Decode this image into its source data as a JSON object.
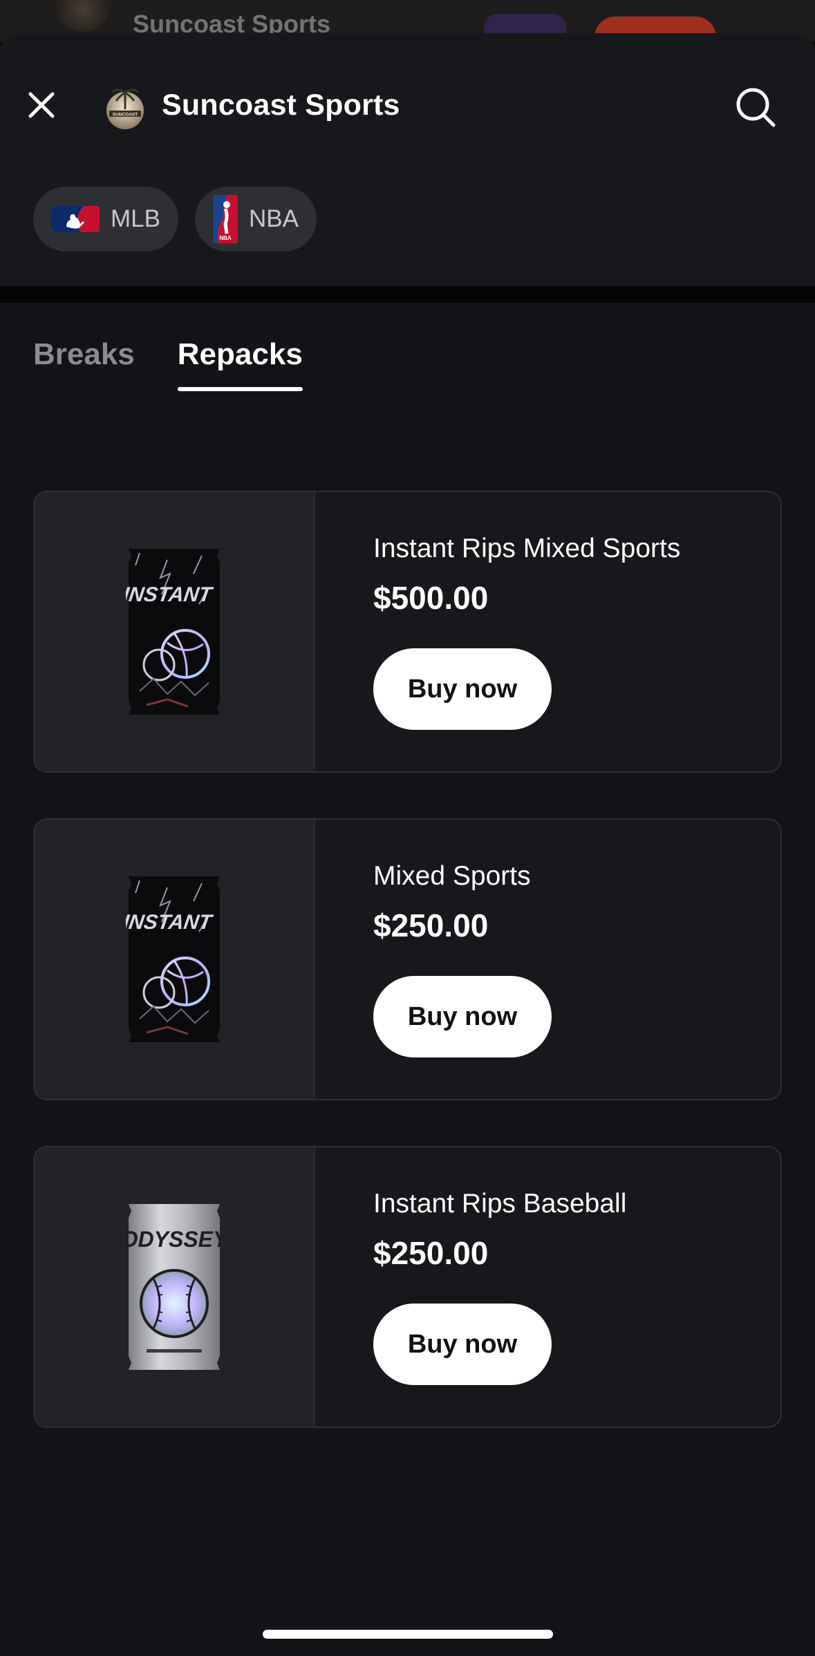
{
  "background": {
    "title": "Suncoast Sports"
  },
  "header": {
    "title": "Suncoast Sports",
    "close_icon": "close-icon",
    "search_icon": "search-icon",
    "logo_text": "SUNCOAST"
  },
  "leagues": [
    {
      "label": "MLB",
      "icon": "mlb-logo-icon"
    },
    {
      "label": "NBA",
      "icon": "nba-logo-icon"
    }
  ],
  "tabs": [
    {
      "label": "Breaks",
      "active": false
    },
    {
      "label": "Repacks",
      "active": true
    }
  ],
  "products": [
    {
      "name": "Instant Rips Mixed Sports",
      "price": "$500.00",
      "button": "Buy now",
      "pack": "INSTANT RIPS"
    },
    {
      "name": "Mixed Sports",
      "price": "$250.00",
      "button": "Buy now",
      "pack": "INSTANT RIPS"
    },
    {
      "name": "Instant Rips Baseball",
      "price": "$250.00",
      "button": "Buy now",
      "pack": "ODYSSEY"
    }
  ],
  "colors": {
    "sheet": "#17181b",
    "content": "#121316",
    "chip": "#2d2f33",
    "button": "#ffffff"
  }
}
